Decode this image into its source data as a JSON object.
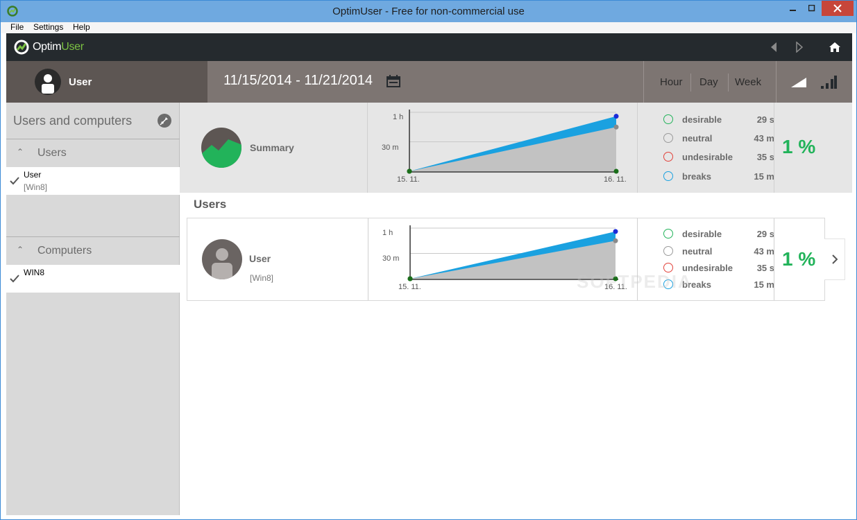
{
  "window": {
    "title": "OptimUser - Free for non-commercial use"
  },
  "menu": {
    "file": "File",
    "settings": "Settings",
    "help": "Help"
  },
  "logo": {
    "part1": "Optim",
    "part2": "User"
  },
  "header": {
    "user": "User",
    "date_range": "11/15/2014 - 11/21/2014",
    "periods": [
      "Hour",
      "Day",
      "Week"
    ]
  },
  "sidebar": {
    "title": "Users and computers",
    "users_section": "Users",
    "user_item": {
      "name": "User",
      "sub": "[Win8]"
    },
    "computers_section": "Computers",
    "computer_item": {
      "name": "WIN8"
    }
  },
  "summary": {
    "label": "Summary",
    "percent": "1 %",
    "legend": [
      {
        "label": "desirable",
        "value": "29 s"
      },
      {
        "label": "neutral",
        "value": "43 m"
      },
      {
        "label": "undesirable",
        "value": "35 s"
      },
      {
        "label": "breaks",
        "value": "15 m"
      }
    ]
  },
  "users_section": {
    "title": "Users",
    "row": {
      "name": "User",
      "sub": "[Win8]",
      "percent": "1 %",
      "legend": [
        {
          "label": "desirable",
          "value": "29 s"
        },
        {
          "label": "neutral",
          "value": "43 m"
        },
        {
          "label": "undesirable",
          "value": "35 s"
        },
        {
          "label": "breaks",
          "value": "15 m"
        }
      ]
    }
  },
  "colors": {
    "desirable": "#22b35a",
    "neutral": "#9a9a9a",
    "undesirable": "#e2413a",
    "breaks": "#1aa1e0",
    "accent": "#7bc142"
  },
  "chart_data": [
    {
      "type": "area",
      "x": [
        "15. 11.",
        "16. 11."
      ],
      "y_ticks": [
        "1 h",
        "30 m"
      ],
      "series": [
        {
          "values": [
            0,
            56
          ]
        },
        {
          "values": [
            0,
            45
          ]
        },
        {
          "values": [
            0,
            0
          ]
        }
      ]
    },
    {
      "type": "area",
      "x": [
        "15. 11.",
        "16. 11."
      ],
      "y_ticks": [
        "1 h",
        "30 m"
      ],
      "series": [
        {
          "values": [
            0,
            56
          ]
        },
        {
          "values": [
            0,
            45
          ]
        },
        {
          "values": [
            0,
            0
          ]
        }
      ]
    }
  ],
  "watermark": "SOFTPEDIA"
}
